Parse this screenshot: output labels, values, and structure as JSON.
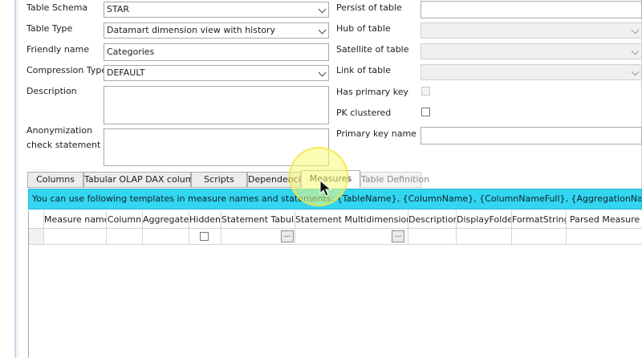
{
  "form": {
    "table_schema": {
      "label": "Table Schema",
      "value": "STAR"
    },
    "table_type": {
      "label": "Table Type",
      "value": "Datamart dimension view with history"
    },
    "friendly_name": {
      "label": "Friendly name",
      "value": "Categories"
    },
    "compression_type": {
      "label": "Compression Type",
      "value": "DEFAULT"
    },
    "description": {
      "label": "Description",
      "value": ""
    },
    "anonymization": {
      "label_line1": "Anonymization",
      "label_line2": "check statement",
      "value": ""
    },
    "persist_of_table": {
      "label": "Persist of table",
      "value": ""
    },
    "hub_of_table": {
      "label": "Hub of table",
      "value": ""
    },
    "satellite_of_table": {
      "label": "Satellite of table",
      "value": ""
    },
    "link_of_table": {
      "label": "Link of table",
      "value": ""
    },
    "has_primary_key": {
      "label": "Has primary key",
      "checked": false
    },
    "pk_clustered": {
      "label": "PK clustered",
      "checked": false
    },
    "primary_key_name": {
      "label": "Primary key name",
      "value": ""
    }
  },
  "tabs": [
    {
      "label": "Columns"
    },
    {
      "label": "Tabular OLAP DAX columns"
    },
    {
      "label": "Scripts"
    },
    {
      "label": "Dependencies"
    },
    {
      "label": "Measures",
      "active": true
    },
    {
      "label": "Table Definition",
      "disabled": true
    }
  ],
  "info_bar": {
    "text": "You can use following templates in measure names and statements: {TableName}, {ColumnName}, {ColumnNameFull}, {AggregationName}, {AggregationStatement},",
    "color": "#33d6f0"
  },
  "grid": {
    "columns": [
      "Measure name",
      "Column",
      "Aggregate",
      "Hidden",
      "Statement Tabular",
      "Statement Multidimensional",
      "Description",
      "DisplayFolder",
      "FormatString",
      "Parsed Measure Na"
    ],
    "ellipsis": "..."
  },
  "icons": {
    "combo_arrow": "chevron-down-icon",
    "cursor": "mouse-pointer-icon"
  }
}
